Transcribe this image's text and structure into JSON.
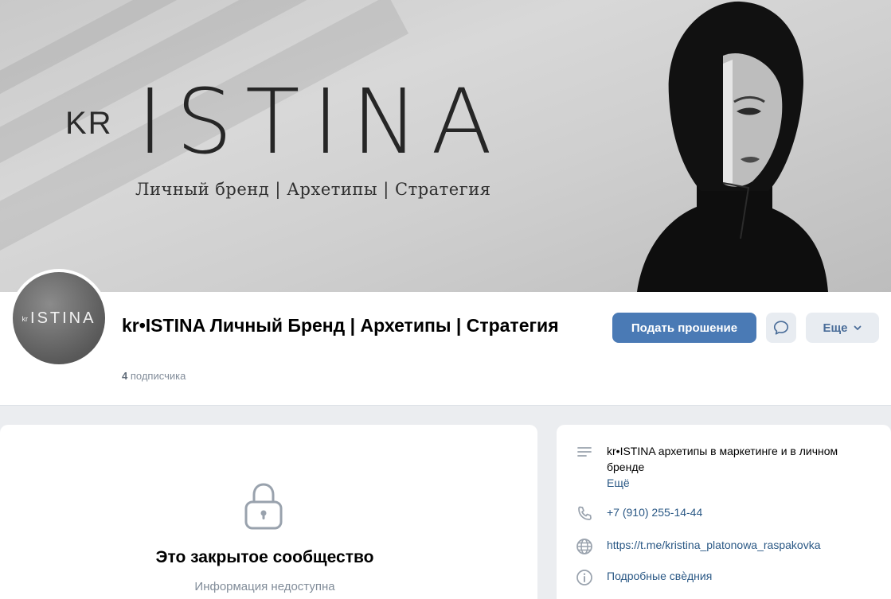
{
  "cover": {
    "brand_prefix": "KR",
    "brand_title": "ISTINA",
    "tagline": "Личный бренд | Архетипы | Стратегия"
  },
  "avatar": {
    "prefix": "kr",
    "title": "ISTINA"
  },
  "group": {
    "name": "kr•ISTINA Личный Бренд | Архетипы | Стратегия",
    "subscribers_count": "4",
    "subscribers_label": "подписчика"
  },
  "actions": {
    "request_label": "Подать прошение",
    "message_icon": "message-bubble-icon",
    "more_label": "Еще",
    "more_icon": "chevron-down-icon"
  },
  "closed": {
    "icon": "lock-icon",
    "title": "Это закрытое сообщество",
    "subtitle": "Информация недоступна"
  },
  "info": {
    "description": "kr•ISTINA архетипы в маркетинге и в личном бренде",
    "description_more": "Ещё",
    "phone": "+7 (910) 255-14-44",
    "website": "https://t.me/kristina_platonowa_raspakovka",
    "details_label": "Подробные свѐдния"
  },
  "colors": {
    "accent": "#4a7ab5",
    "link": "#2a5885",
    "secondary_text": "#818c99",
    "icon": "#99a2ad"
  }
}
